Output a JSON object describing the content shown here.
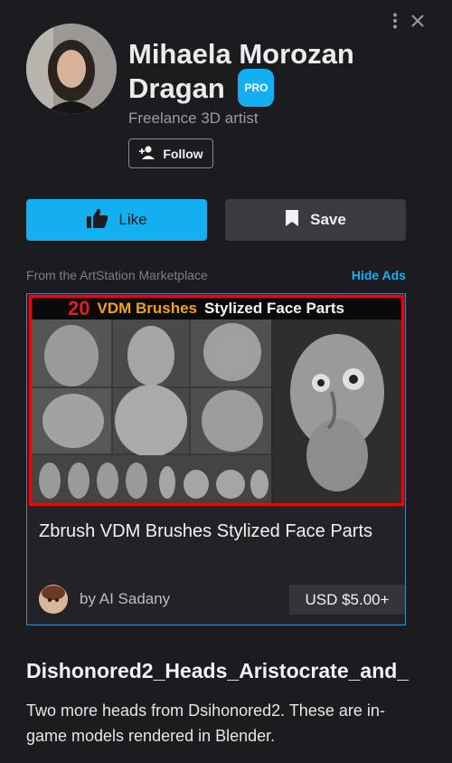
{
  "profile": {
    "name": "Mihaela Morozan Dragan",
    "badge": "PRO",
    "subtitle": "Freelance 3D artist",
    "follow_label": "Follow"
  },
  "actions": {
    "like_label": "Like",
    "save_label": "Save"
  },
  "ads": {
    "section_label": "From the ArtStation Marketplace",
    "hide_label": "Hide Ads",
    "image_banner": {
      "number": "20",
      "vdm": "VDM Brushes",
      "rest": "Stylized  Face Parts"
    },
    "title": "Zbrush VDM Brushes Stylized Face Parts",
    "author": "by AI Sadany",
    "price": "USD $5.00+"
  },
  "post": {
    "title": "Dishonored2_Heads_Aristocrate_and_",
    "description": "Two more heads from Dsihonored2. These are in-game models rendered in Blender."
  },
  "icons": [
    "more-vertical-icon",
    "close-icon",
    "add-user-icon",
    "thumbs-up-icon",
    "bookmark-icon"
  ],
  "colors": {
    "accent": "#13aff0",
    "background": "#1c1c20",
    "ad_border": "#3e89b2",
    "ad_image_frame": "#e10b0b"
  }
}
